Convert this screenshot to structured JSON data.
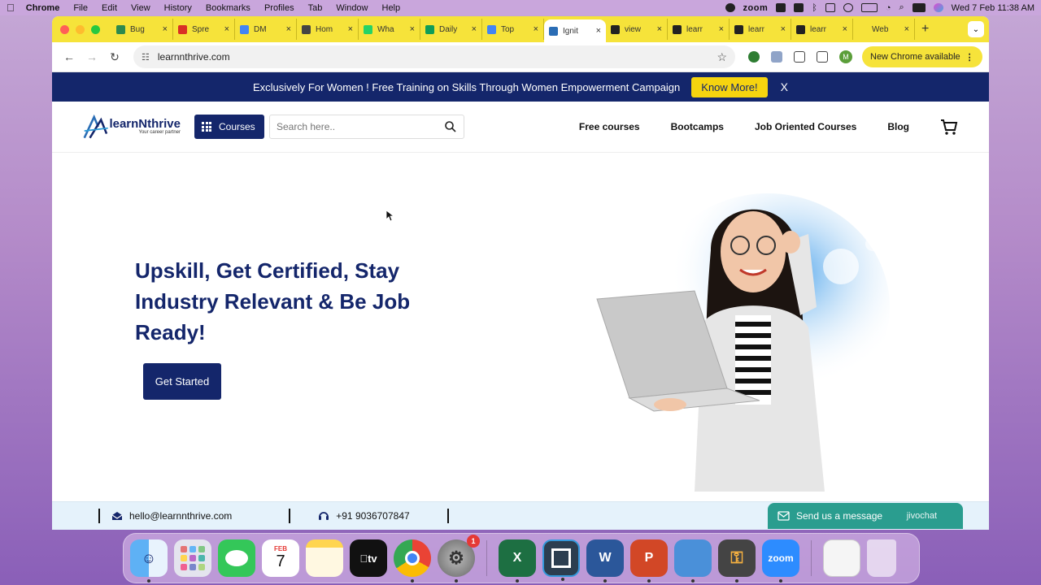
{
  "menubar": {
    "app": "Chrome",
    "items": [
      "File",
      "Edit",
      "View",
      "History",
      "Bookmarks",
      "Profiles",
      "Tab",
      "Window",
      "Help"
    ],
    "zoom_label": "zoom",
    "datetime": "Wed 7 Feb  11:38 AM"
  },
  "tabs": [
    {
      "title": "Bug",
      "icon": "jira-icon",
      "color": "#2d8a4e"
    },
    {
      "title": "Spre",
      "icon": "gmail-icon",
      "color": "#d93025"
    },
    {
      "title": "DM",
      "icon": "docs-icon",
      "color": "#4285f4"
    },
    {
      "title": "Hom",
      "icon": "link-icon",
      "color": "#444444"
    },
    {
      "title": "Wha",
      "icon": "whatsapp-icon",
      "color": "#25d366"
    },
    {
      "title": "Daily",
      "icon": "sheets-icon",
      "color": "#0f9d58"
    },
    {
      "title": "Top",
      "icon": "docs-icon",
      "color": "#4285f4"
    },
    {
      "title": "Ignit",
      "icon": "learnnthrive-icon",
      "color": "#2a6db5",
      "active": true
    },
    {
      "title": "view",
      "icon": "app-icon",
      "color": "#222222"
    },
    {
      "title": "learr",
      "icon": "app-icon",
      "color": "#222222"
    },
    {
      "title": "learr",
      "icon": "app-icon",
      "color": "#222222"
    },
    {
      "title": "learr",
      "icon": "app-icon",
      "color": "#222222"
    },
    {
      "title": "Web",
      "icon": "p-icon",
      "color": "#f6e33a"
    }
  ],
  "toolbar": {
    "url": "learnnthrive.com",
    "new_chrome_label": "New Chrome available",
    "avatar_letter": "M"
  },
  "promo": {
    "text": "Exclusively For Women ! Free Training on Skills Through Women Empowerment Campaign",
    "button": "Know More!",
    "close": "X"
  },
  "header": {
    "logo_name": "learnNthrive",
    "logo_tagline": "Your career partner",
    "courses_label": "Courses",
    "search_placeholder": "Search here..",
    "nav": [
      "Free courses",
      "Bootcamps",
      "Job Oriented Courses",
      "Blog"
    ]
  },
  "hero": {
    "headline": "Upskill, Get Certified, Stay Industry Relevant & Be Job Ready!",
    "cta": "Get Started"
  },
  "footer": {
    "email": "hello@learnnthrive.com",
    "phone": "+91 9036707847"
  },
  "chat": {
    "label": "Send us a message",
    "brand": "jivochat"
  },
  "dock": {
    "apps": [
      "finder",
      "launchpad",
      "messages",
      "calendar",
      "notes",
      "appletv",
      "chrome",
      "settings",
      "excel",
      "screen",
      "word",
      "powerpoint",
      "archive",
      "keychain",
      "zoom",
      "preview",
      "trash"
    ],
    "calendar_month": "FEB",
    "calendar_day": "7",
    "settings_badge": "1",
    "zoom_label": "zoom"
  },
  "colors": {
    "brand_navy": "#14266b",
    "promo_yellow": "#f6d40f",
    "tab_bar": "#f6e33a",
    "chat_teal": "#2a9d8f"
  }
}
